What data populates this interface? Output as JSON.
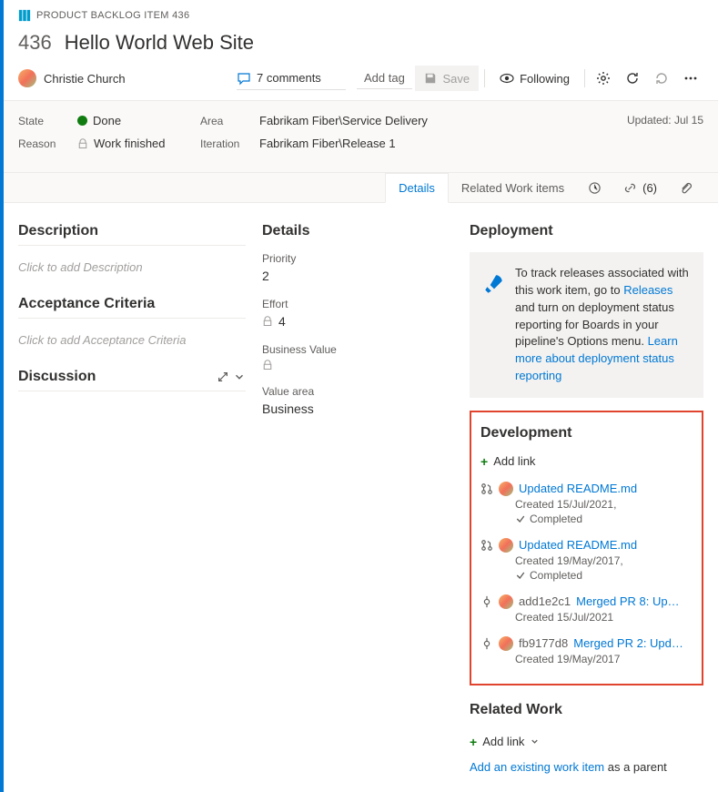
{
  "header": {
    "type_label": "PRODUCT BACKLOG ITEM 436",
    "id": "436",
    "title": "Hello World Web Site"
  },
  "assignee": {
    "name": "Christie Church"
  },
  "comments": {
    "count_text": "7 comments"
  },
  "addtag": "Add tag",
  "toolbar": {
    "save": "Save",
    "following": "Following"
  },
  "meta": {
    "state_label": "State",
    "state_value": "Done",
    "reason_label": "Reason",
    "reason_value": "Work finished",
    "area_label": "Area",
    "area_value": "Fabrikam Fiber\\Service Delivery",
    "iteration_label": "Iteration",
    "iteration_value": "Fabrikam Fiber\\Release 1",
    "updated": "Updated: Jul 15"
  },
  "tabs": {
    "details": "Details",
    "related": "Related Work items",
    "links_count": "(6)"
  },
  "left": {
    "description_title": "Description",
    "description_placeholder": "Click to add Description",
    "acceptance_title": "Acceptance Criteria",
    "acceptance_placeholder": "Click to add Acceptance Criteria",
    "discussion_title": "Discussion"
  },
  "mid": {
    "title": "Details",
    "priority_label": "Priority",
    "priority_value": "2",
    "effort_label": "Effort",
    "effort_value": "4",
    "bv_label": "Business Value",
    "va_label": "Value area",
    "va_value": "Business"
  },
  "right": {
    "deployment_title": "Deployment",
    "deployment_text1": "To track releases associated with this work item, go to ",
    "deployment_link1": "Releases",
    "deployment_text2": " and turn on deployment status reporting for Boards in your pipeline's Options menu. ",
    "deployment_link2": "Learn more about deployment status reporting",
    "development_title": "Development",
    "add_link": "Add link",
    "dev_items": [
      {
        "kind": "pr",
        "title": "Updated README.md",
        "sub": "Created 15/Jul/2021,",
        "status": "Completed"
      },
      {
        "kind": "pr",
        "title": "Updated README.md",
        "sub": "Created 19/May/2017,",
        "status": "Completed"
      },
      {
        "kind": "commit",
        "hash": "add1e2c1",
        "title": "Merged PR 8: Up…",
        "sub": "Created 15/Jul/2021"
      },
      {
        "kind": "commit",
        "hash": "fb9177d8",
        "title": "Merged PR 2: Upd…",
        "sub": "Created 19/May/2017"
      }
    ],
    "related_title": "Related Work",
    "related_add": "Add link",
    "parent_link": "Add an existing work item",
    "parent_suffix": " as a parent"
  }
}
